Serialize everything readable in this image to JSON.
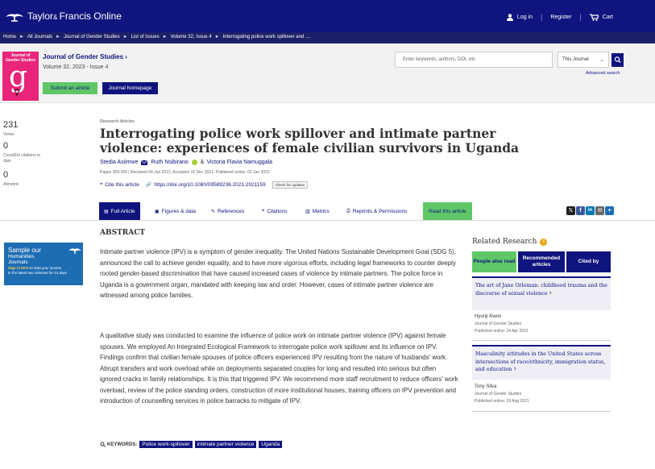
{
  "header": {
    "brand": "Taylor & Francis Online",
    "brand_pre": "Taylor",
    "brand_amp": "& ",
    "brand_post": "Francis Online",
    "login": "Log in",
    "register": "Register",
    "cart": "Cart"
  },
  "breadcrumb": [
    "Home",
    "All Journals",
    "Journal of Gender Studies",
    "List of Issues",
    "Volume 32, Issue 4",
    "Interrogating police work spillover and ...."
  ],
  "journal": {
    "cover_title": "Journal of Gender Studies",
    "name": "Journal of Gender Studies",
    "volume": "Volume 32, 2023 - Issue 4",
    "submit_label": "Submit an article",
    "homepage_label": "Journal homepage"
  },
  "search": {
    "placeholder": "Enter keywords, authors, DOI, etc",
    "scope": "This Journal",
    "advanced": "Advanced search"
  },
  "metrics": [
    {
      "value": "231",
      "label": "Views"
    },
    {
      "value": "0",
      "label": "CrossRef citations to date"
    },
    {
      "value": "0",
      "label": "Altmetric"
    }
  ],
  "article": {
    "section": "Research Articles",
    "title": "Interrogating police work spillover and intimate partner violence: experiences of female civilian survivors in Uganda",
    "author1": "Stedia Asiimwe",
    "author2": "Ruth Nsibirano",
    "author_amp": "&",
    "author3": "Victoria Flavia Namuggala",
    "pubinfo": "Pages 359-369 | Received 04 Jun 2021, Accepted 16 Dec 2021, Published online: 02 Jan 2022",
    "cite": "Cite this article",
    "doi": "https://doi.org/10.1080/09589236.2021.2021159",
    "check_updates": "Check for updates"
  },
  "tabs": {
    "full": "Full Article",
    "figures": "Figures & data",
    "references": "References",
    "citations": "Citations",
    "metrics": "Metrics",
    "reprints": "Reprints & Permissions",
    "read": "Read this article"
  },
  "share_icons": [
    "x-icon",
    "facebook-icon",
    "linkedin-icon",
    "email-icon",
    "share-plus-icon"
  ],
  "ad": {
    "line1": "Sample our",
    "line2": "Humanities",
    "line3": "Journals",
    "sign_in": "Sign in here",
    "rest1": " to start your access",
    "rest2": "to the latest two volumes for 14 days"
  },
  "abstract": {
    "heading": "ABSTRACT",
    "para1": "Intimate partner violence (IPV) is a symptom of gender inequality. The United Nations Sustainable Development Goal (SDG 5), announced the call to achieve gender equality, and to have more vigorous efforts, including legal frameworks to counter deeply rooted gender-based discrimination that have caused increased cases of violence by intimate partners. The police force in Uganda is a government organ, mandated with keeping law and order. However, cases of intimate partner violence are witnessed among police families.",
    "para2": "A qualitative study was conducted to examine the influence of police work on intimate partner violence (IPV) against female spouses. We employed An Integrated Ecological Framework to interrogate police work spillover and its influence on IPV. Findings confirm that civilian female spouses of police officers experienced IPV resulting from the nature of husbands' work. Abrupt transfers and work overload while on deployments separated couples for long and resulted into serious but often ignored cracks in family relationships. It is this that triggered IPV. We recommend more staff recruitment to reduce officers' work overload, review of the police standing orders, construction of more institutional houses, training officers on IPV prevention and introduction of counselling services in police barracks to mitigate of IPV."
  },
  "keywords": {
    "label": "KEYWORDS:",
    "items": [
      "Police work-spillover",
      "intimate partner violence",
      "Uganda"
    ]
  },
  "related": {
    "heading": "Related Research",
    "tab1": "People also read",
    "tab2": "Recommended articles",
    "tab3": "Cited by",
    "items": [
      {
        "title": "The art of Jane Orleman: childhood trauma and the discourse of sexual violence",
        "author": "Hyunji Kwon",
        "journal": "Journal of Gender Studies",
        "date": "Published online: 24 Apr 2022"
      },
      {
        "title": "Masculinity attitudes in the United States across intersections of race/ethnicity, immigration status, and education",
        "author": "Tony Silva",
        "journal": "Journal of Gender Studies",
        "date": "Published online: 19 Aug 2021"
      }
    ]
  }
}
